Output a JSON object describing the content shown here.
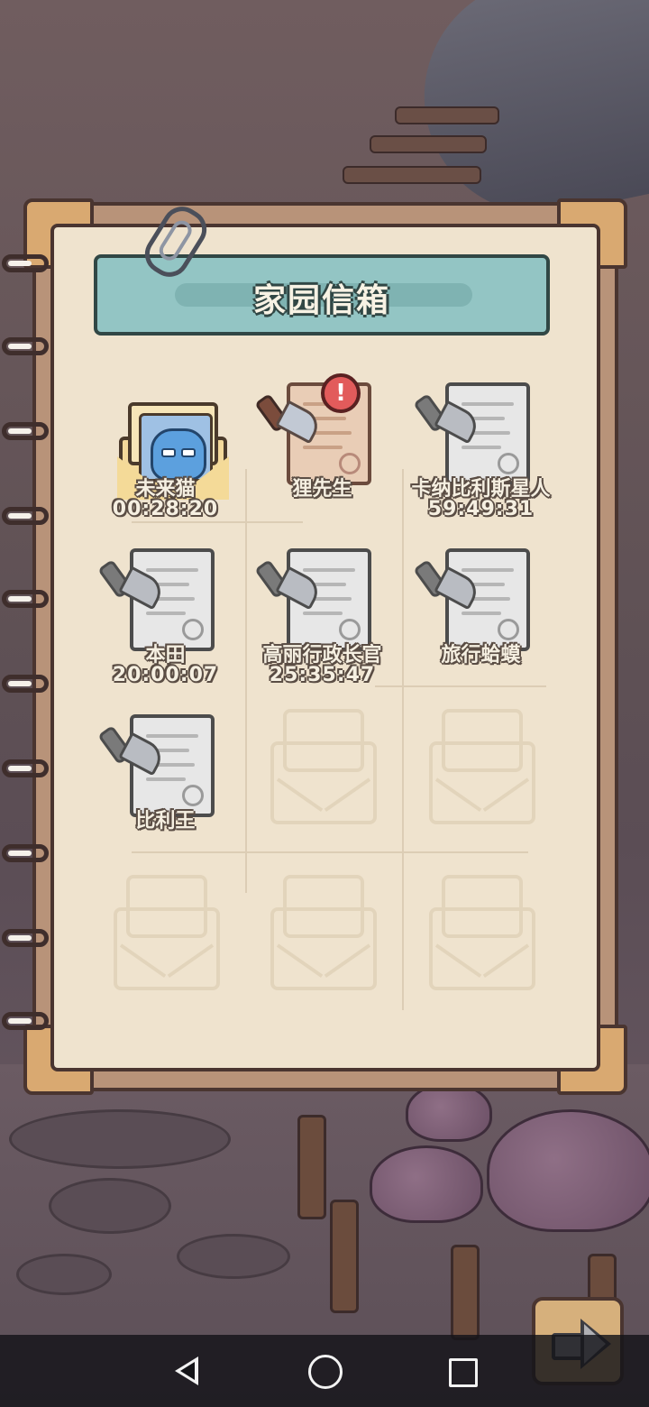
{
  "mailbox": {
    "title": "家园信箱",
    "letters": [
      {
        "name": "未来猫",
        "timer": "00:28:20",
        "state": "photo-envelope"
      },
      {
        "name": "狸先生",
        "timer": "",
        "state": "new",
        "badge": "!"
      },
      {
        "name": "卡纳比利斯星人",
        "timer": "59:49:31",
        "state": "locked"
      },
      {
        "name": "本田",
        "timer": "20:00:07",
        "state": "locked"
      },
      {
        "name": "高丽行政长官",
        "timer": "25:35:47",
        "state": "locked"
      },
      {
        "name": "旅行蛤蟆",
        "timer": "",
        "state": "locked"
      },
      {
        "name": "比利王",
        "timer": "",
        "state": "locked"
      }
    ],
    "empty_slots": 5
  },
  "buttons": {
    "next": "arrow-right-icon"
  },
  "system_nav": {
    "back": "back-icon",
    "home": "home-icon",
    "recent": "recent-apps-icon"
  },
  "colors": {
    "header": "#93c5c4",
    "paper": "#efe3ce",
    "frame": "#b89379",
    "badge": "#e25b5b"
  }
}
